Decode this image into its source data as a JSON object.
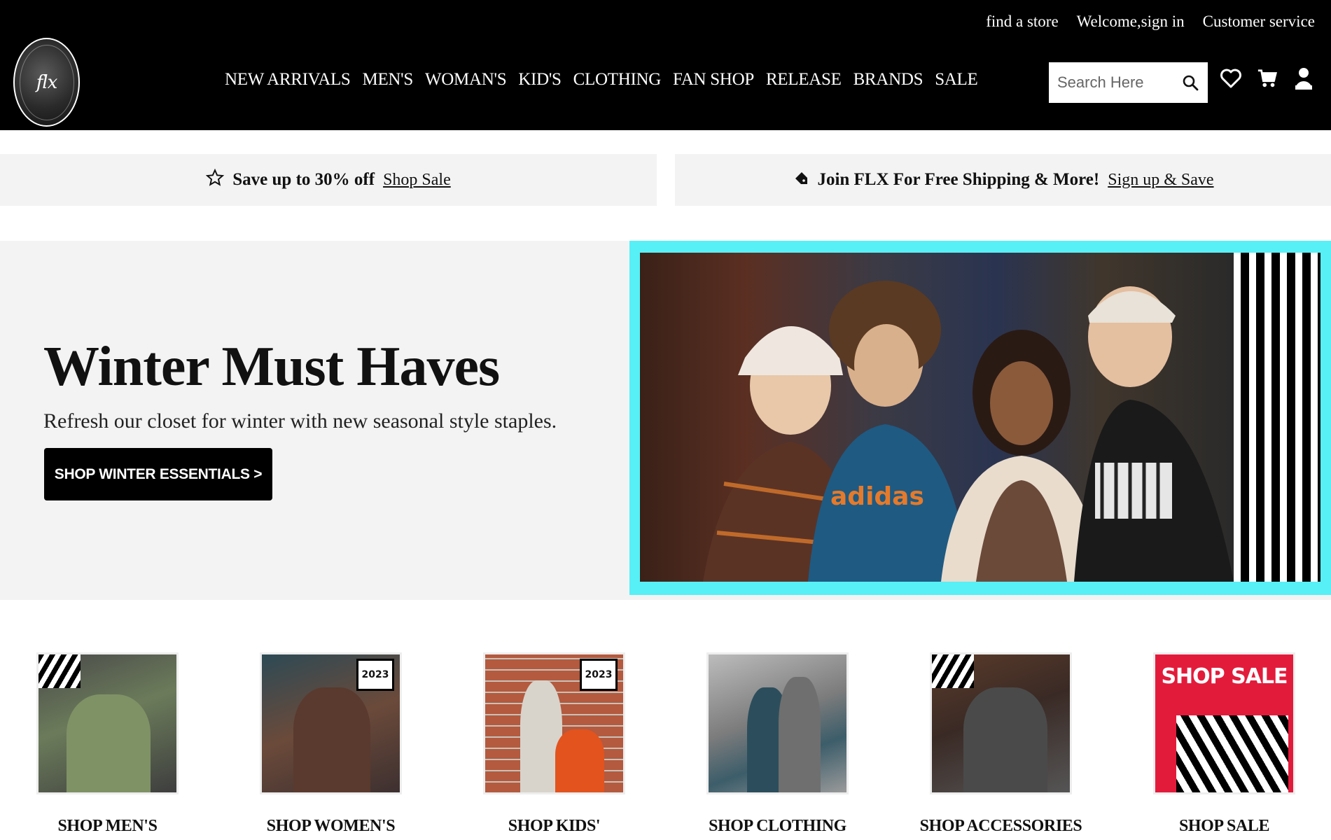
{
  "header": {
    "utility_links": [
      "find a store",
      "Welcome,sign in",
      "Customer service"
    ],
    "nav": [
      "NEW ARRIVALS",
      "MEN'S",
      "WOMAN'S",
      "KID'S",
      "CLOTHING",
      "FAN SHOP",
      "RELEASE",
      "BRANDS",
      "SALE"
    ],
    "search": {
      "placeholder": "Search Here",
      "icon": "search-icon"
    },
    "icons": [
      "heart-icon",
      "cart-icon",
      "user-icon"
    ]
  },
  "promos": {
    "left": {
      "icon": "star-icon",
      "text": "Save up to 30% off",
      "link": "Shop Sale"
    },
    "right": {
      "icon": "tag-icon",
      "text": "Join FLX For Free Shipping & More!",
      "link": "Sign up & Save"
    }
  },
  "hero": {
    "title": "Winter Must Haves",
    "subtitle": "Refresh our closet for winter with new seasonal style staples.",
    "button": "SHOP WINTER ESSENTIALS >"
  },
  "categories": [
    {
      "label": "SHOP MEN'S"
    },
    {
      "label": "SHOP WOMEN'S",
      "badge": "2023"
    },
    {
      "label": "SHOP KIDS'",
      "badge": "2023"
    },
    {
      "label": "SHOP CLOTHING"
    },
    {
      "label": "SHOP ACCESSORIES"
    },
    {
      "label": "SHOP SALE",
      "tile_text": "SHOP SALE"
    }
  ],
  "colors": {
    "header_bg": "#000000",
    "promo_bg": "#f3f3f3",
    "hero_frame": "#56f0f6",
    "sale_red": "#e31b3b"
  }
}
